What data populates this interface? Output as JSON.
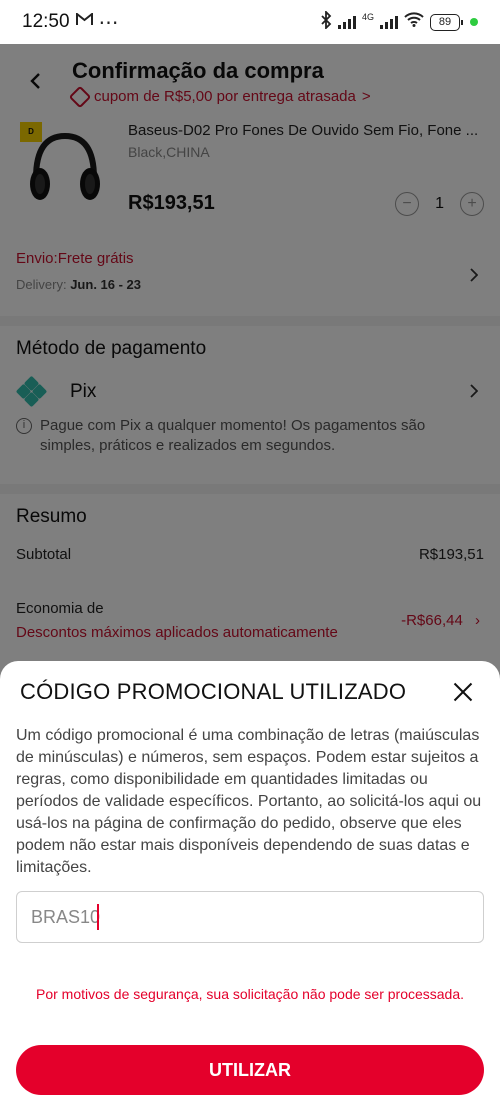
{
  "status_bar": {
    "time": "12:50",
    "left_icons": [
      "gmail-icon",
      "more-dots-icon"
    ],
    "network": "4G",
    "battery": "89"
  },
  "header": {
    "title": "Confirmação da compra",
    "coupon_text": "cupom de R$5,00 por entrega atrasada",
    "coupon_chevron": ">"
  },
  "product": {
    "badge": "D",
    "title": "Baseus-D02 Pro Fones De Ouvido Sem Fio, Fone ...",
    "variant": "Black,CHINA",
    "price": "R$193,51",
    "quantity": "1",
    "minus": "−",
    "plus": "+"
  },
  "shipping": {
    "label": "Envio:Frete grátis",
    "delivery_label": "Delivery:",
    "delivery_dates": "Jun. 16 - 23"
  },
  "payment": {
    "title": "Método de pagamento",
    "method": "Pix",
    "note": "Pague com Pix a qualquer momento! Os pagamentos são simples, práticos e realizados em segundos."
  },
  "summary": {
    "title": "Resumo",
    "subtotal_label": "Subtotal",
    "subtotal_value": "R$193,51",
    "savings_label": "Economia de",
    "savings_note": "Descontos máximos aplicados automaticamente",
    "savings_value": "-R$66,44"
  },
  "promo_sheet": {
    "title": "CÓDIGO PROMOCIONAL UTILIZADO",
    "description": "Um código promocional é uma combinação de letras (maiúsculas de minúsculas) e números, sem espaços. Podem estar sujeitos a regras, como disponibilidade em quantidades limitadas ou períodos de validade específicos. Portanto, ao solicitá-los aqui ou usá-los na página de confirmação do pedido, observe que eles podem não estar mais disponíveis dependendo de suas datas e limitações.",
    "input_value": "BRAS10",
    "error": "Por motivos de segurança, sua solicitação não pode ser processada.",
    "button_label": "UTILIZAR"
  },
  "colors": {
    "accent_red": "#e4002b",
    "pix_teal": "#32bcad"
  }
}
